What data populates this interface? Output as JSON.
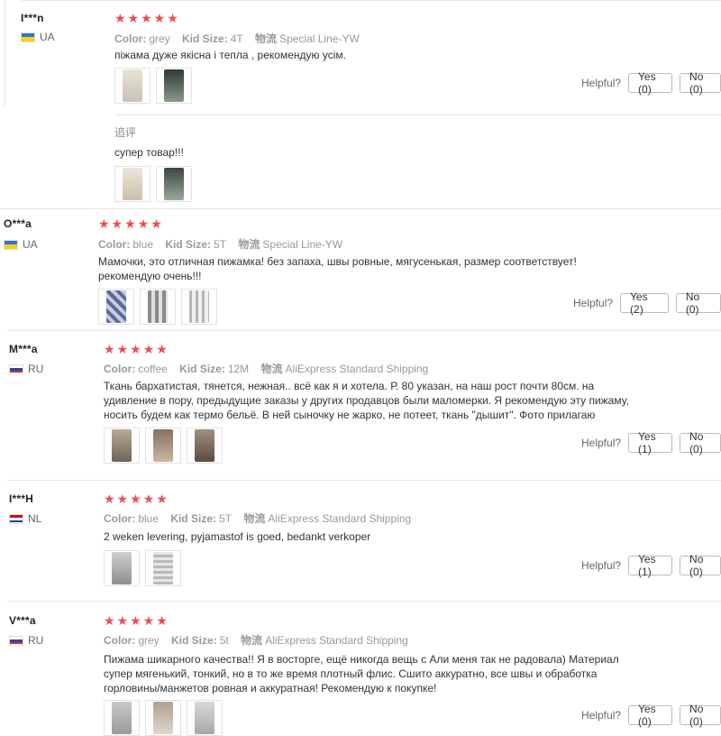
{
  "colors": {
    "star": "#f14c4c",
    "border": "#e6e6e6",
    "muted": "#999999"
  },
  "reviews": [
    {
      "user": "I***n",
      "country": "UA",
      "flag": "ukraine-flag-icon",
      "stars": "★★★★★",
      "attrs": [
        {
          "k": "Color:",
          "v": "grey"
        },
        {
          "k": "Kid Size:",
          "v": "4T"
        },
        {
          "k": "物流",
          "v": "Special Line-YW"
        }
      ],
      "text": "піжама дуже якісна і тепла , рекомендую усім.",
      "helpful_label": "Helpful?",
      "yes": "Yes (0)",
      "no": "No (0)",
      "followup_label": "追评",
      "followup_text": "супер товар!!!"
    },
    {
      "user": "O***a",
      "country": "UA",
      "flag": "ukraine-flag-icon",
      "stars": "★★★★★",
      "attrs": [
        {
          "k": "Color:",
          "v": "blue"
        },
        {
          "k": "Kid Size:",
          "v": "5T"
        },
        {
          "k": "物流",
          "v": "Special Line-YW"
        }
      ],
      "text": "Мамочки, это отличная пижамка! без запаха, швы ровные, мягусенькая, размер соответствует! рекомендую очень!!!",
      "helpful_label": "Helpful?",
      "yes": "Yes (2)",
      "no": "No (0)"
    },
    {
      "user": "M***a",
      "country": "RU",
      "flag": "russia-flag-icon",
      "stars": "★★★★★",
      "attrs": [
        {
          "k": "Color:",
          "v": "coffee"
        },
        {
          "k": "Kid Size:",
          "v": "12M"
        },
        {
          "k": "物流",
          "v": "AliExpress Standard Shipping"
        }
      ],
      "text": "Ткань бархатистая, тянется, нежная.. всё как я и хотела. Р. 80 указан, на наш рост почти 80см. на удивление в пору, предыдущие заказы у других продавцов были маломерки. Я рекомендую эту пижаму, носить будем как термо бельё. В ней сыночку не жарко, не потеет, ткань \"дышит\". Фото прилагаю",
      "helpful_label": "Helpful?",
      "yes": "Yes (1)",
      "no": "No (0)"
    },
    {
      "user": "I***H",
      "country": "NL",
      "flag": "netherlands-flag-icon",
      "stars": "★★★★★",
      "attrs": [
        {
          "k": "Color:",
          "v": "blue"
        },
        {
          "k": "Kid Size:",
          "v": "5T"
        },
        {
          "k": "物流",
          "v": "AliExpress Standard Shipping"
        }
      ],
      "text": "2 weken levering, pyjamastof is goed, bedankt verkoper",
      "helpful_label": "Helpful?",
      "yes": "Yes (1)",
      "no": "No (0)"
    },
    {
      "user": "V***a",
      "country": "RU",
      "flag": "russia-flag-icon",
      "stars": "★★★★★",
      "attrs": [
        {
          "k": "Color:",
          "v": "grey"
        },
        {
          "k": "Kid Size:",
          "v": "5t"
        },
        {
          "k": "物流",
          "v": "AliExpress Standard Shipping"
        }
      ],
      "text": "Пижама шикарного качества!! Я в восторге, ещё никогда вещь с Али меня так не радовала) Материал супер мягенький, тонкий, но в то же время плотный флис. Сшито аккуратно, все швы и обработка горловины/манжетов ровная и аккуратная! Рекомендую к покупке!",
      "helpful_label": "Helpful?",
      "yes": "Yes (0)",
      "no": "No (0)"
    }
  ]
}
